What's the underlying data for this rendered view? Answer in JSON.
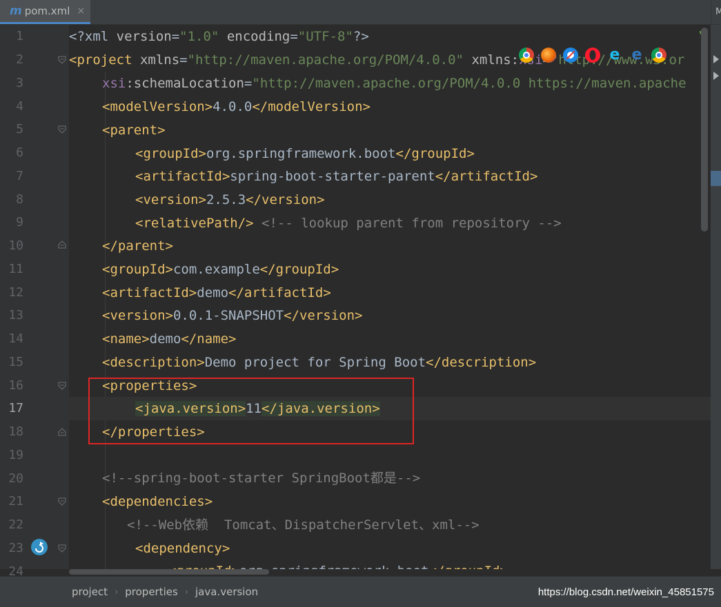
{
  "tab": {
    "icon": "m",
    "label": "pom.xml",
    "close": "×"
  },
  "right_tab_label": "M",
  "colors": {
    "tag": "#e8bf6a",
    "attr": "#bababa",
    "string": "#6a8759",
    "comment": "#808080",
    "namespace": "#9876aa",
    "text": "#a9b7c6",
    "highlight_box": "#e02525",
    "accent": "#4a88c7"
  },
  "gutter": {
    "line_numbers": [
      "1",
      "2",
      "3",
      "4",
      "5",
      "6",
      "7",
      "8",
      "9",
      "10",
      "11",
      "12",
      "13",
      "14",
      "15",
      "16",
      "17",
      "18",
      "19",
      "20",
      "21",
      "22",
      "23",
      "24"
    ],
    "current_line": "17"
  },
  "browser_icons": [
    "chrome-icon",
    "firefox-icon",
    "safari-icon",
    "opera-icon",
    "ie-icon",
    "edge-icon",
    "chrome-icon"
  ],
  "code": {
    "l1": {
      "a": "<?xml ",
      "b": "version",
      "c": "=",
      "d": "\"1.0\"",
      "e": " ",
      "f": "encoding",
      "g": "=",
      "h": "\"UTF-8\"",
      "i": "?>"
    },
    "l2": {
      "a": "<project ",
      "b": "xmlns",
      "c": "=",
      "d": "\"http://maven.apache.org/POM/4.0.0\"",
      "e": " ",
      "f": "xmlns",
      "g": ":",
      "h": "xsi",
      "i": "=",
      "j": "\"http://www.w3.or"
    },
    "l3": {
      "a": "xsi",
      "b": ":schemaLocation",
      "c": "=",
      "d": "\"http://maven.apache.org/POM/4.0.0 https://maven.apache"
    },
    "l4": {
      "a": "<modelVersion>",
      "b": "4.0.0",
      "c": "</modelVersion>"
    },
    "l5": {
      "a": "<parent>"
    },
    "l6": {
      "a": "<groupId>",
      "b": "org.springframework.boot",
      "c": "</groupId>"
    },
    "l7": {
      "a": "<artifactId>",
      "b": "spring-boot-starter-parent",
      "c": "</artifactId>"
    },
    "l8": {
      "a": "<version>",
      "b": "2.5.3",
      "c": "</version>"
    },
    "l9": {
      "a": "<relativePath/>",
      "b": " <!-- lookup parent from repository -->"
    },
    "l10": {
      "a": "</parent>"
    },
    "l11": {
      "a": "<groupId>",
      "b": "com.example",
      "c": "</groupId>"
    },
    "l12": {
      "a": "<artifactId>",
      "b": "demo",
      "c": "</artifactId>"
    },
    "l13": {
      "a": "<version>",
      "b": "0.0.1-SNAPSHOT",
      "c": "</version>"
    },
    "l14": {
      "a": "<name>",
      "b": "demo",
      "c": "</name>"
    },
    "l15": {
      "a": "<description>",
      "b": "Demo project for Spring Boot",
      "c": "</description>"
    },
    "l16": {
      "a": "<properties>"
    },
    "l17": {
      "a": "<java.version>",
      "b": "11",
      "c": "</java.version>"
    },
    "l18": {
      "a": "</properties>"
    },
    "l20": {
      "a": "<!--spring-boot-starter SpringBoot都是-->"
    },
    "l21": {
      "a": "<dependencies>"
    },
    "l22": {
      "a": "<!--Web依赖  Tomcat、DispatcherServlet、xml-->"
    },
    "l23": {
      "a": "<dependency>"
    },
    "l24": {
      "a": "<groupId>",
      "b": "org.springframework.boot",
      "c": "</groupId>"
    }
  },
  "breadcrumb": [
    "project",
    "properties",
    "java.version"
  ],
  "breadcrumb_sep": "›",
  "watermark": "https://blog.csdn.net/weixin_45851575",
  "status_check": "✔"
}
